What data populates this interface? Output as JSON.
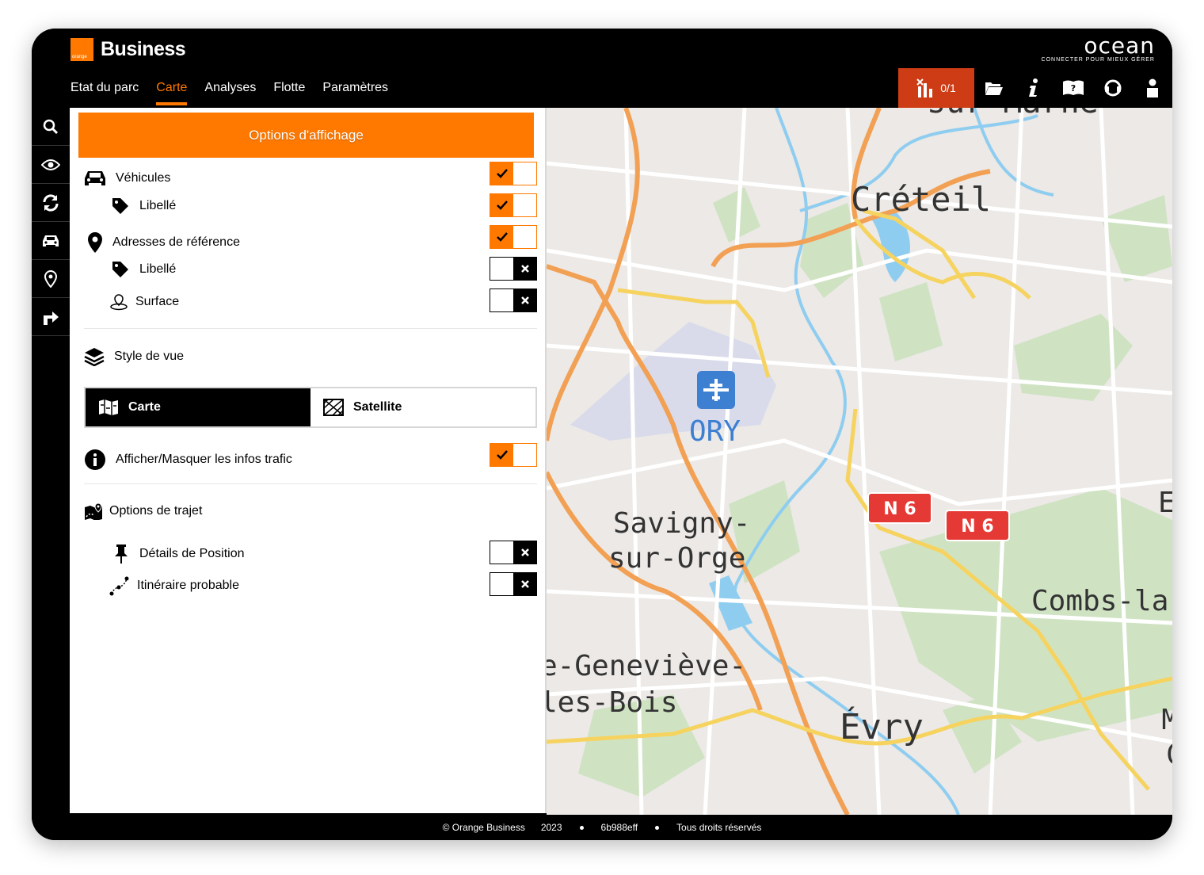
{
  "header": {
    "brand": "Business",
    "logo_small": "orange",
    "nav": [
      {
        "label": "Etat du parc",
        "active": false
      },
      {
        "label": "Carte",
        "active": true
      },
      {
        "label": "Analyses",
        "active": false
      },
      {
        "label": "Flotte",
        "active": false
      },
      {
        "label": "Paramètres",
        "active": false
      }
    ],
    "ocean_logo": "ocean",
    "ocean_tagline": "CONNECTER POUR MIEUX GÉRER",
    "alerts_count": "0/1",
    "toolbar_icons": [
      "folder-icon",
      "info-icon",
      "help-book-icon",
      "support-headset-icon",
      "user-icon"
    ]
  },
  "rail": [
    "search-icon",
    "eye-icon",
    "refresh-icon",
    "car-icon",
    "location-pin-icon",
    "route-arrow-icon"
  ],
  "panel": {
    "title": "Options d'affichage",
    "vehicules": "Véhicules",
    "vehicules_libelle": "Libellé",
    "adresses": "Adresses de référence",
    "adresses_libelle": "Libellé",
    "surface": "Surface",
    "style_title": "Style de vue",
    "style_carte": "Carte",
    "style_satellite": "Satellite",
    "trafic": "Afficher/Masquer les infos trafic",
    "trajet_title": "Options de trajet",
    "details_position": "Détails de Position",
    "itineraire": "Itinéraire probable"
  },
  "map": {
    "places": {
      "creteil": "Créteil",
      "ory": "ORY",
      "savigny1": "Savigny-",
      "savigny2": "sur-Orge",
      "genevieve1": "e-Geneviève-",
      "genevieve2": "les-Bois",
      "evry": "Évry",
      "combs": "Combs-la-Vi",
      "top": "sur-Marne",
      "right_e": "E",
      "right_m": "M",
      "right_cr": "Cr"
    },
    "road_shield": "N 6"
  },
  "footer": {
    "copyright": "© Orange Business",
    "year": "2023",
    "hash": "6b988eff",
    "rights": "Tous droits réservés"
  }
}
